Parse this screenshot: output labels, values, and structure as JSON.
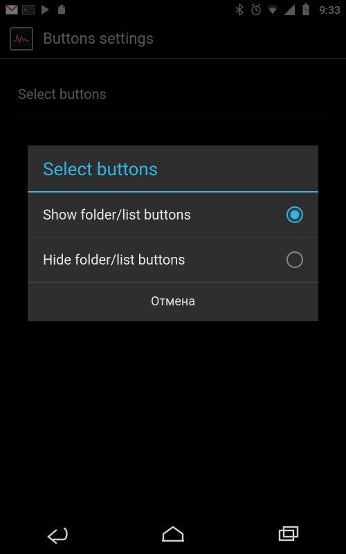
{
  "status_bar": {
    "clock": "9:33",
    "left_icons": [
      "gmail-icon",
      "terminal-icon",
      "play-store-icon",
      "android-icon"
    ],
    "right_icons": [
      "bluetooth-icon",
      "alarm-icon",
      "wifi-icon",
      "signal-icon",
      "battery-charging-icon"
    ]
  },
  "action_bar": {
    "title": "Buttons settings",
    "icon": "app-waveform-icon"
  },
  "page": {
    "setting_label": "Select buttons"
  },
  "dialog": {
    "title": "Select buttons",
    "options": [
      {
        "label": "Show folder/list buttons",
        "selected": true
      },
      {
        "label": "Hide folder/list buttons",
        "selected": false
      }
    ],
    "cancel_label": "Отмена"
  },
  "nav_bar": {
    "buttons": [
      "back-button",
      "home-button",
      "recent-apps-button"
    ]
  },
  "colors": {
    "accent": "#33b5e5",
    "dialog_bg": "#2e2e2e",
    "text_muted": "#bdbdbd"
  }
}
